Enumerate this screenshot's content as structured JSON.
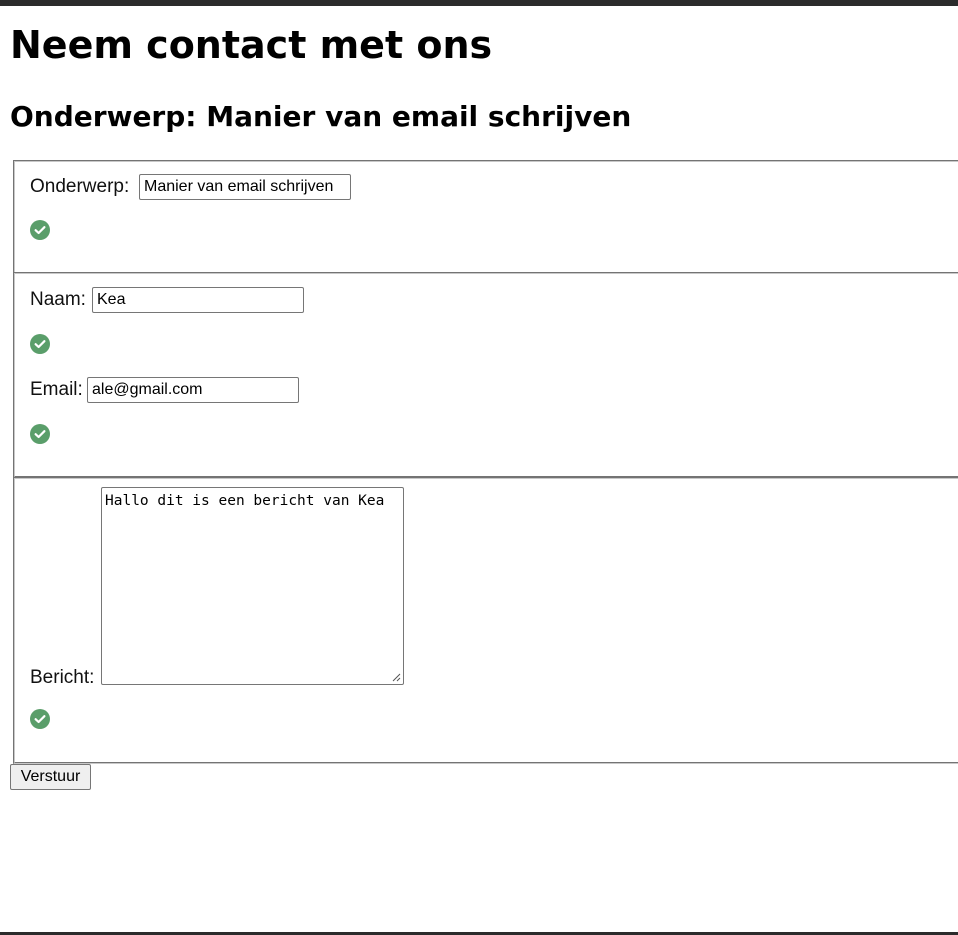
{
  "page": {
    "heading": "Neem contact met ons",
    "subheading": "Onderwerp: Manier van email schrijven"
  },
  "form": {
    "onderwerp": {
      "label": "Onderwerp:",
      "value": "Manier van email schrijven"
    },
    "naam": {
      "label": "Naam:",
      "value": "Kea"
    },
    "email": {
      "label": "Email:",
      "value": "ale@gmail.com"
    },
    "bericht": {
      "label": "Bericht:",
      "value": "Hallo dit is een bericht van Kea"
    },
    "submit_label": "Verstuur"
  },
  "icons": {
    "valid": "check-circle-icon"
  },
  "colors": {
    "valid_green": "#5a9e6a"
  }
}
